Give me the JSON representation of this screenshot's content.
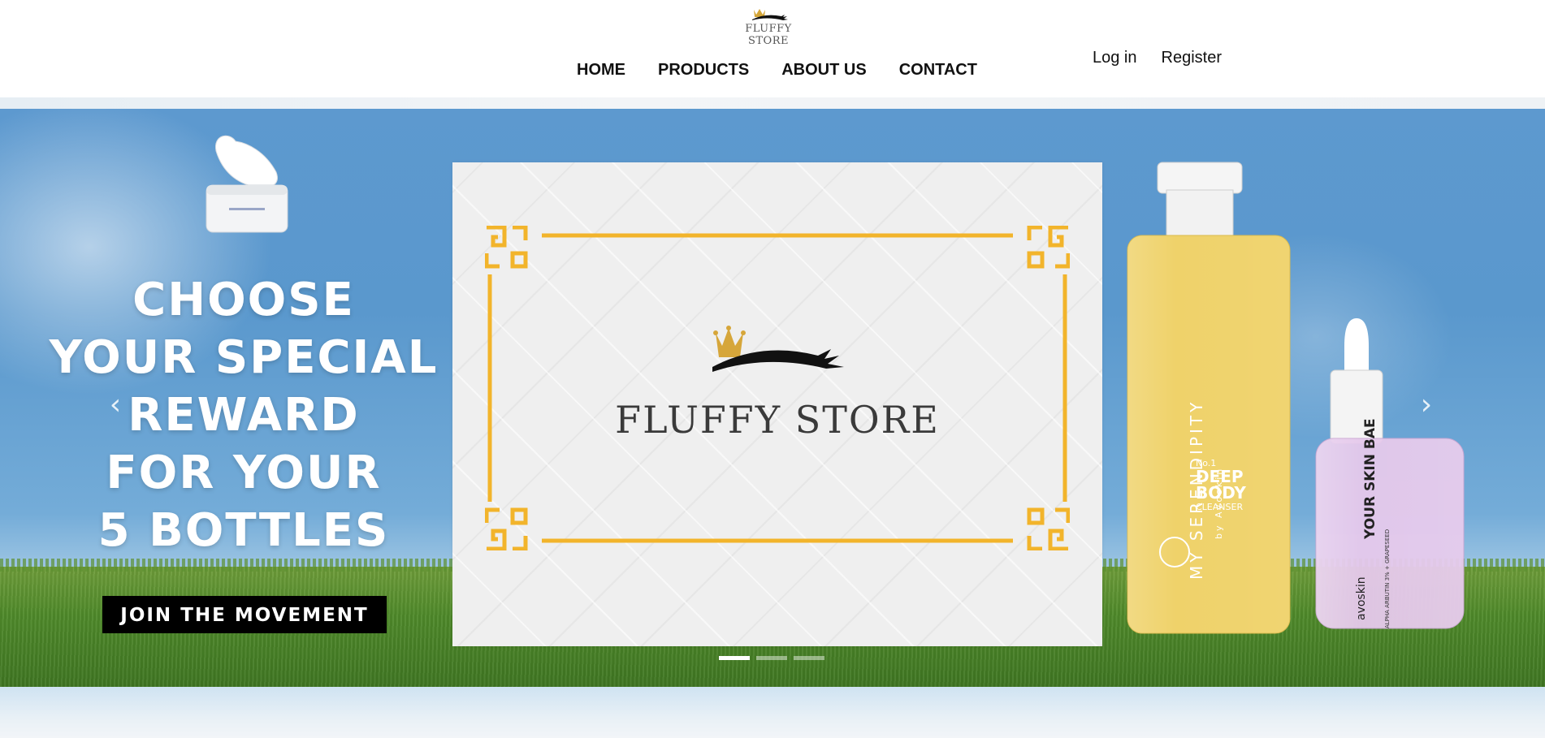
{
  "brand": {
    "name": "FLUFFY STORE",
    "accent_gold": "#f2b42b",
    "logo_icon": "crown-eyelash-logo"
  },
  "nav": {
    "items": [
      {
        "label": "HOME"
      },
      {
        "label": "PRODUCTS"
      },
      {
        "label": "ABOUT US"
      },
      {
        "label": "CONTACT"
      }
    ]
  },
  "auth": {
    "login_label": "Log in",
    "register_label": "Register"
  },
  "hero": {
    "headline_lines": [
      "CHOOSE",
      "YOUR SPECIAL",
      "REWARD",
      "FOR YOUR",
      "5 BOTTLES"
    ],
    "cta_label": "JOIN THE MOVEMENT",
    "card_brand": "FLUFFY STORE",
    "prev_icon": "chevron-left-icon",
    "next_icon": "chevron-right-icon",
    "slide_count": 3,
    "active_slide": 1,
    "products": {
      "bottle_left": {
        "title": "MY SERENDIPITY",
        "subtitle": "by Avoskin",
        "number": "No.1",
        "line1": "DEEP",
        "line2": "BODY",
        "line3": "CLEANSER"
      },
      "bottle_right": {
        "brand": "avoskin",
        "title": "YOUR SKIN BAE",
        "line": "ALPHA ARBUTIN 3% + GRAPESEED"
      }
    }
  }
}
